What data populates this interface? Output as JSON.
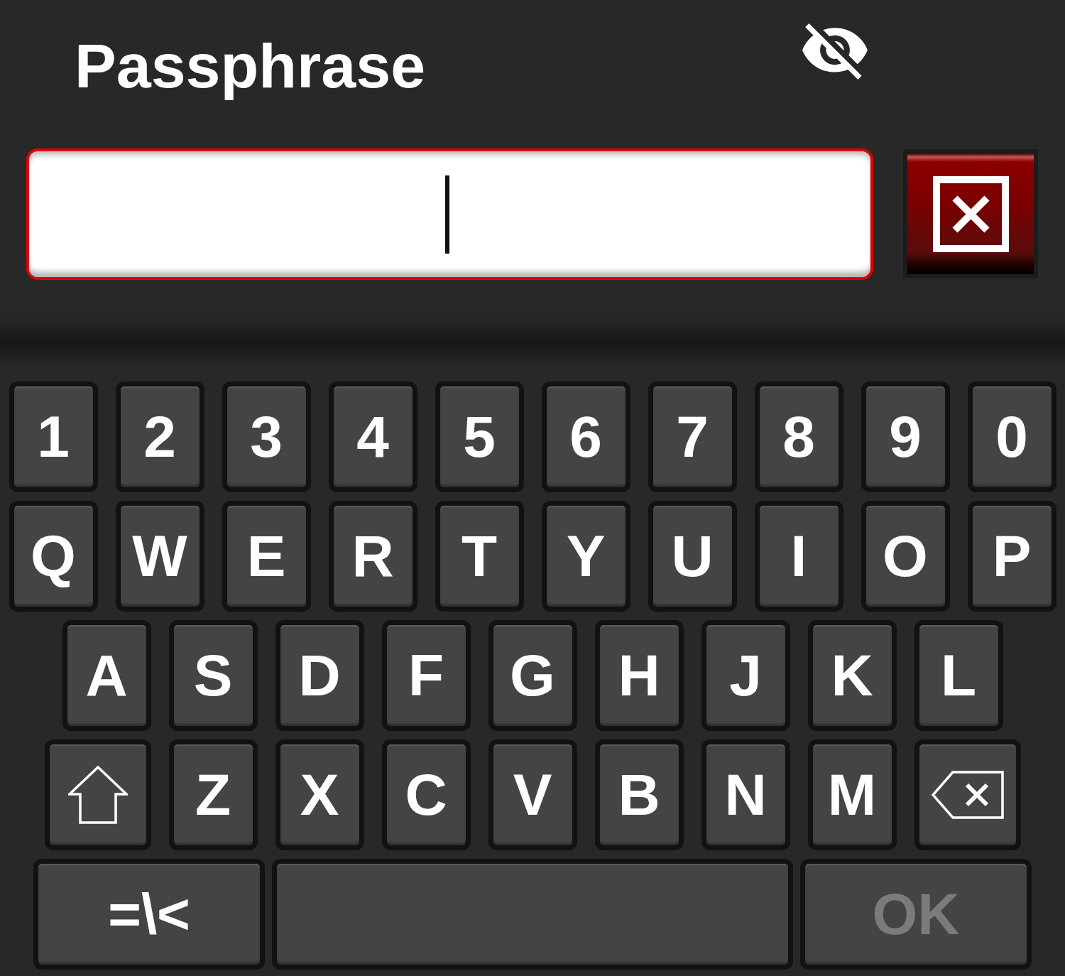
{
  "title": "Passphrase",
  "visibility_toggle": {
    "password_visible": false
  },
  "input": {
    "focused": true
  },
  "keyboard": {
    "rows": [
      [
        {
          "kind": "char",
          "label": "1"
        },
        {
          "kind": "char",
          "label": "2"
        },
        {
          "kind": "char",
          "label": "3"
        },
        {
          "kind": "char",
          "label": "4"
        },
        {
          "kind": "char",
          "label": "5"
        },
        {
          "kind": "char",
          "label": "6"
        },
        {
          "kind": "char",
          "label": "7"
        },
        {
          "kind": "char",
          "label": "8"
        },
        {
          "kind": "char",
          "label": "9"
        },
        {
          "kind": "char",
          "label": "0"
        }
      ],
      [
        {
          "kind": "char",
          "label": "Q"
        },
        {
          "kind": "char",
          "label": "W"
        },
        {
          "kind": "char",
          "label": "E"
        },
        {
          "kind": "char",
          "label": "R"
        },
        {
          "kind": "char",
          "label": "T"
        },
        {
          "kind": "char",
          "label": "Y"
        },
        {
          "kind": "char",
          "label": "U"
        },
        {
          "kind": "char",
          "label": "I"
        },
        {
          "kind": "char",
          "label": "O"
        },
        {
          "kind": "char",
          "label": "P"
        }
      ],
      [
        {
          "kind": "char",
          "label": "A"
        },
        {
          "kind": "char",
          "label": "S"
        },
        {
          "kind": "char",
          "label": "D"
        },
        {
          "kind": "char",
          "label": "F"
        },
        {
          "kind": "char",
          "label": "G"
        },
        {
          "kind": "char",
          "label": "H"
        },
        {
          "kind": "char",
          "label": "J"
        },
        {
          "kind": "char",
          "label": "K"
        },
        {
          "kind": "char",
          "label": "L"
        }
      ],
      [
        {
          "kind": "shift"
        },
        {
          "kind": "char",
          "label": "Z"
        },
        {
          "kind": "char",
          "label": "X"
        },
        {
          "kind": "char",
          "label": "C"
        },
        {
          "kind": "char",
          "label": "V"
        },
        {
          "kind": "char",
          "label": "B"
        },
        {
          "kind": "char",
          "label": "N"
        },
        {
          "kind": "char",
          "label": "M"
        },
        {
          "kind": "backspace"
        }
      ]
    ],
    "bottom_row": {
      "symbols_key": {
        "label": "=\\<"
      },
      "ok_key": {
        "label": "OK",
        "disabled": true
      }
    }
  }
}
